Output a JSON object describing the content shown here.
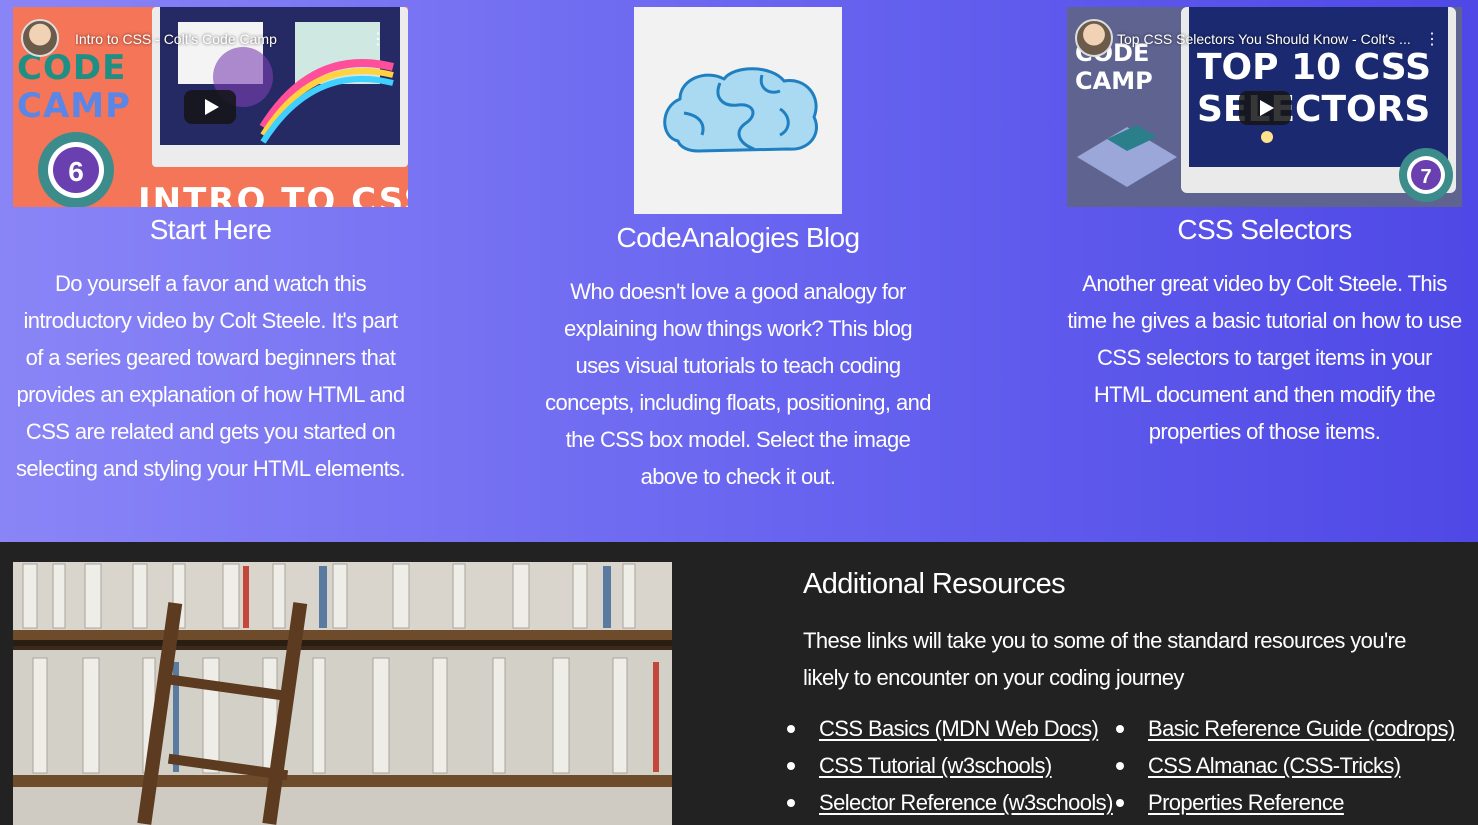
{
  "cards": [
    {
      "video_title": "Intro to CSS - Colt's Code Camp",
      "thumb_text_top": "COLT'S CODE CAMP",
      "thumb_text_bottom": "INTRO TO CSS",
      "badge": "6",
      "title": "Start Here",
      "body": "Do yourself a favor and watch this introductory video by Colt Steele. It's part of a series geared toward beginners that provides an explanation of how HTML and CSS are related and gets you started on selecting and styling your HTML elements."
    },
    {
      "title": "CodeAnalogies Blog",
      "body": "Who doesn't love a good analogy for explaining how things work? This blog uses visual tutorials to teach coding concepts, including floats, positioning, and the CSS box model. Select the image above to check it out."
    },
    {
      "video_title": "Top CSS Selectors You Should Know - Colt's ...",
      "thumb_text_top": "COLT'S CODE CAMP",
      "thumb_headline": "TOP 10 CSS SELECTORS",
      "badge": "7",
      "title": "CSS Selectors",
      "body": "Another great video by Colt Steele. This time he gives a basic tutorial on how to use CSS selectors to target items in your HTML document and then modify the properties of those items."
    }
  ],
  "resources": {
    "title": "Additional Resources",
    "intro": "These links will take you to some of the standard resources you're likely to encounter on your coding journey",
    "links_left": [
      "CSS Basics (MDN Web Docs)",
      "CSS Tutorial (w3schools)",
      "Selector Reference (w3schools)"
    ],
    "links_right": [
      "Basic Reference Guide (codrops)",
      "CSS Almanac (CSS-Tricks)",
      "Properties Reference"
    ]
  },
  "icons": {
    "video_play": "play-icon",
    "video_menu": "kebab-menu-icon",
    "blog_logo": "brain-logo-icon"
  },
  "colors": {
    "gradient_start": "#8a85f6",
    "gradient_end": "#4f48e6",
    "dark_section": "#222222"
  }
}
